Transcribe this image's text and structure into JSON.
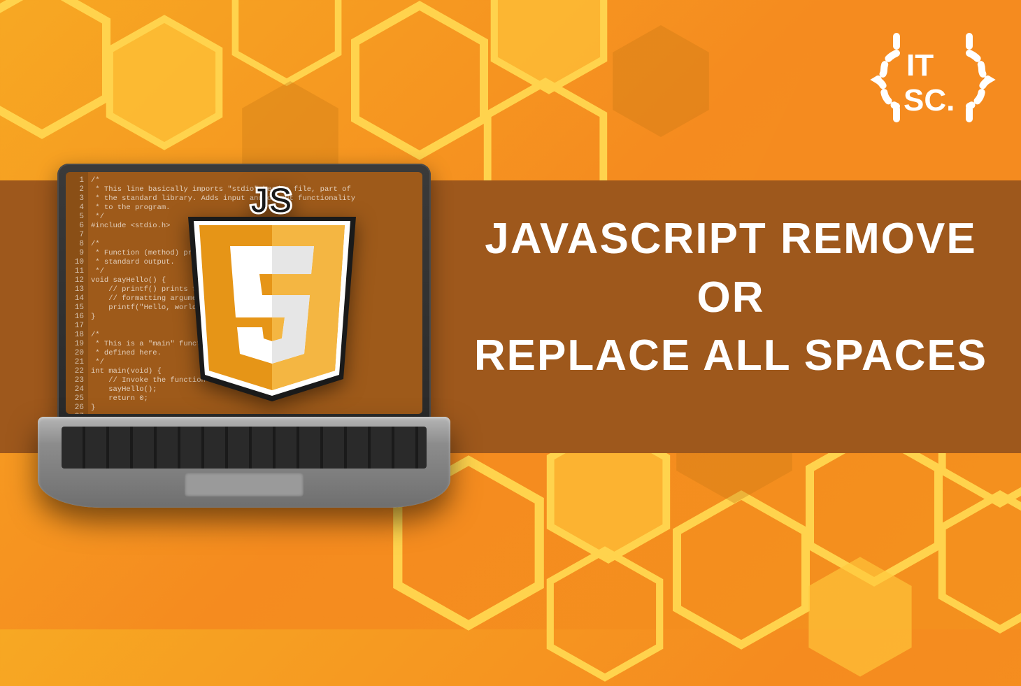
{
  "title": {
    "line1": "JAVASCRIPT REMOVE",
    "line2": "OR",
    "line3": "REPLACE ALL SPACES"
  },
  "logo": {
    "line1": "IT",
    "line2": "SC."
  },
  "badge": {
    "top_label": "JS",
    "shield_letter": "5"
  },
  "code": {
    "line_count": 27,
    "lines": [
      "/*",
      " * This line basically imports \"stdio\" header file, part of",
      " * the standard library. Adds input and output functionality",
      " * to the program.",
      " */",
      "#include <stdio.h>",
      "",
      "/*",
      " * Function (method) prints \"Hello, world\\n\" to",
      " * standard output.",
      " */",
      "void sayHello() {",
      "    // printf() prints formatted text (with optional",
      "    // formatting arguments)",
      "    printf(\"Hello, world\\n\");",
      "}",
      "",
      "/*",
      " * This is a \"main\" function — program will run the code",
      " * defined here.",
      " */",
      "int main(void) {",
      "    // Invoke the function",
      "    sayHello();",
      "    return 0;",
      "}",
      ""
    ]
  },
  "colors": {
    "background_start": "#f7a823",
    "background_end": "#f4911e",
    "band": "#a75d1e",
    "hex_outline": "#ffd34d",
    "title_text": "#ffffff",
    "shield_outer": "#e69517",
    "shield_inner": "#f4b642"
  }
}
